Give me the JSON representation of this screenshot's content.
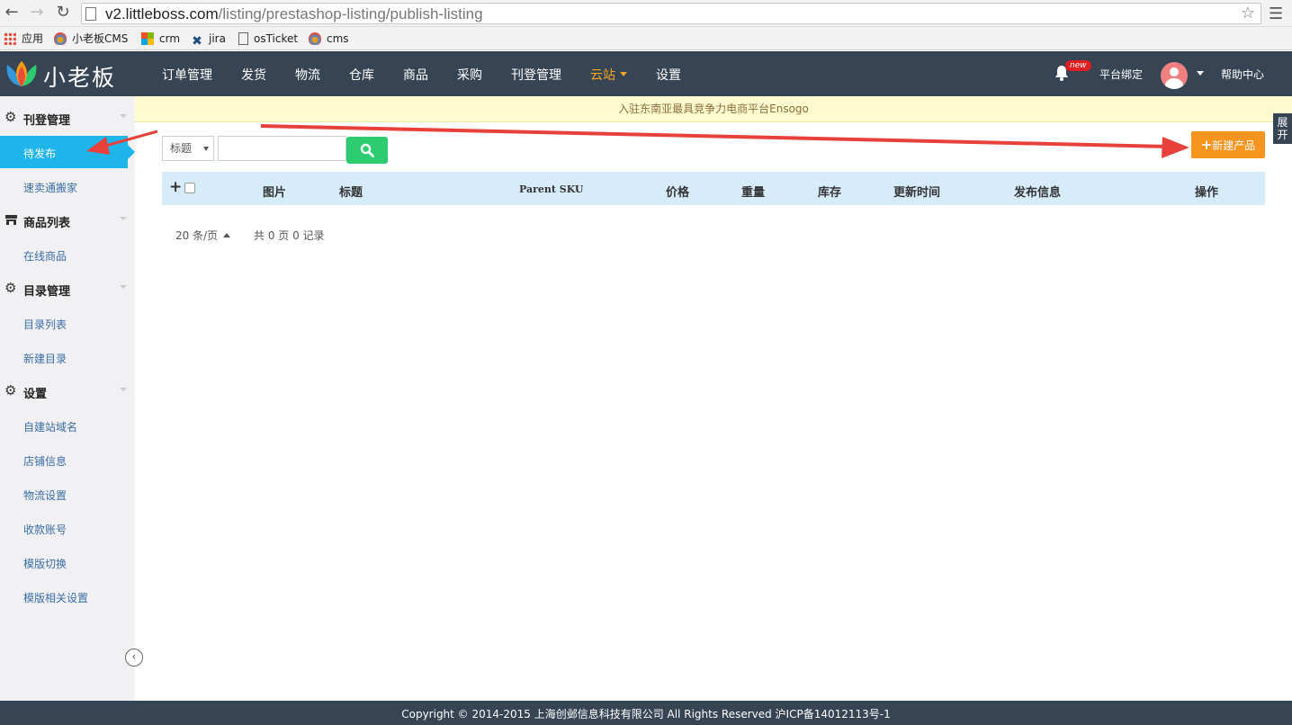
{
  "browser": {
    "url_host": "v2.littleboss.com",
    "url_path": "/listing/prestashop-listing/publish-listing",
    "bookmarks": [
      "应用",
      "小老板CMS",
      "crm",
      "jira",
      "osTicket",
      "cms"
    ]
  },
  "header": {
    "logo": "小老板",
    "nav": [
      "订单管理",
      "发货",
      "物流",
      "仓库",
      "商品",
      "采购",
      "刊登管理",
      "云站",
      "设置"
    ],
    "active_nav": "云站",
    "badge": "new",
    "platform_bind": "平台绑定",
    "help_center": "帮助中心"
  },
  "sidebar": {
    "groups": [
      {
        "label": "刊登管理",
        "icon": "gear-icon",
        "items": [
          "待发布",
          "速卖通搬家"
        ]
      },
      {
        "label": "商品列表",
        "icon": "store-icon",
        "items": [
          "在线商品"
        ]
      },
      {
        "label": "目录管理",
        "icon": "gear-icon",
        "items": [
          "目录列表",
          "新建目录"
        ]
      },
      {
        "label": "设置",
        "icon": "gear-icon",
        "items": [
          "自建站域名",
          "店铺信息",
          "物流设置",
          "收款账号",
          "模版切换",
          "模版相关设置"
        ]
      }
    ],
    "active_item": "待发布"
  },
  "notice": "入驻东南亚最具竞争力电商平台Ensogo",
  "expand_tab": "展开",
  "search": {
    "field_selected": "标题",
    "query": ""
  },
  "new_product_button": "新建产品",
  "table": {
    "columns": [
      "图片",
      "标题",
      "Parent SKU",
      "价格",
      "重量",
      "库存",
      "更新时间",
      "发布信息",
      "操作"
    ],
    "rows": []
  },
  "pagination": {
    "per_page": "20 条/页",
    "summary": "共 0 页 0 记录"
  },
  "footer": "Copyright © 2014-2015 上海创邺信息科技有限公司 All Rights Reserved 沪ICP备14012113号-1",
  "colors": {
    "header_bg": "#374453",
    "active_nav": "#f5a623",
    "sidebar_active": "#1fb5ea",
    "search_button": "#2ecc71",
    "new_button": "#f7941d",
    "table_head": "#d7ecfa",
    "annotation_arrow": "#e8413c"
  }
}
